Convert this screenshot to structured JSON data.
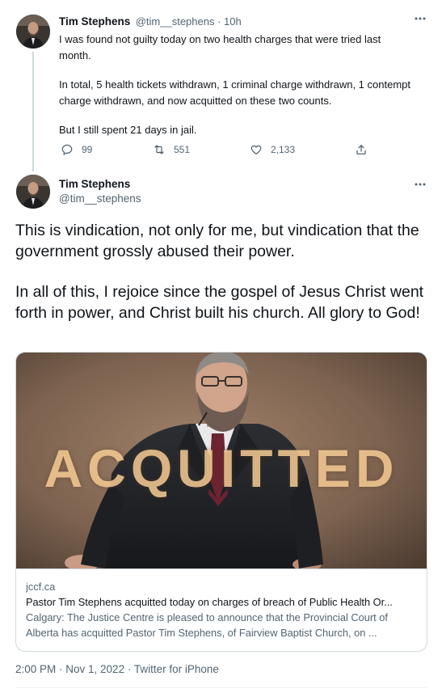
{
  "tweet1": {
    "display_name": "Tim Stephens",
    "handle_time": "@tim__stephens · 10h",
    "paragraphs": [
      "I was found not guilty today on two health charges that were tried last month.",
      "In total, 5 health tickets withdrawn, 1 criminal charge withdrawn, 1 contempt charge withdrawn, and now acquitted on these two counts.",
      "But I still spent 21 days in jail."
    ],
    "actions": {
      "replies": "99",
      "retweets": "551",
      "likes": "2,133"
    }
  },
  "tweet2": {
    "display_name": "Tim Stephens",
    "handle": "@tim__stephens",
    "paragraphs": [
      "This is vindication, not only for me, but vindication that the government grossly abused their power.",
      "In all of this, I rejoice since the gospel of Jesus Christ went forth in power, and Christ built his church. All glory to God!"
    ],
    "card": {
      "overlay_text": "ACQUITTED",
      "domain": "jccf.ca",
      "title": "Pastor Tim Stephens acquitted today on charges of breach of Public Health Or...",
      "description_line1": "Calgary: The Justice Centre is pleased to announce that the Provincial Court of",
      "description_line2": "Alberta has acquitted Pastor Tim Stephens, of Fairview Baptist Church, on ..."
    },
    "timestamp": "2:00 PM · Nov 1, 2022 · Twitter for iPhone"
  },
  "colors": {
    "text_primary": "#0f1419",
    "text_secondary": "#536471",
    "border": "#cfd9de"
  },
  "icons": [
    "more-icon",
    "reply-icon",
    "retweet-icon",
    "like-icon",
    "share-icon"
  ]
}
